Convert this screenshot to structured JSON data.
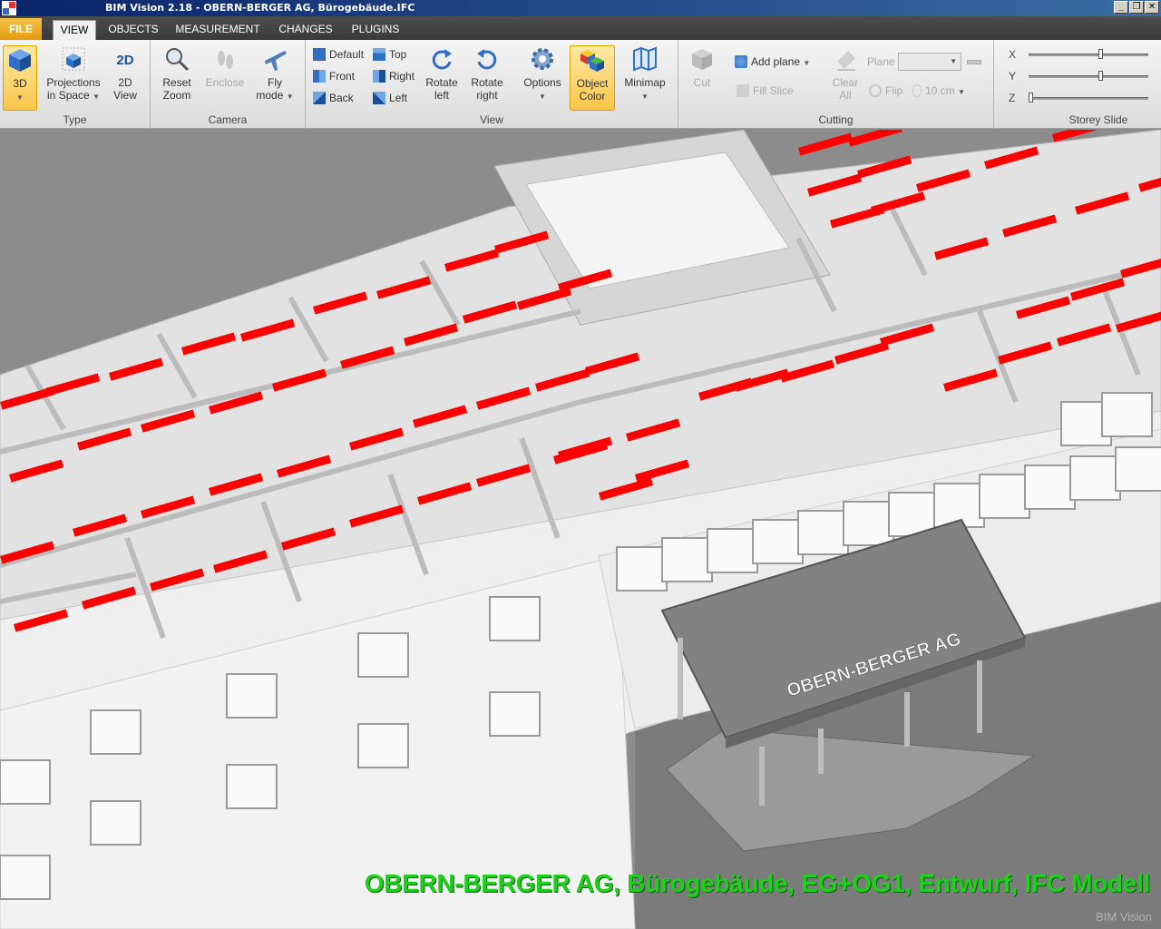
{
  "window": {
    "title": "BIM Vision 2.18 - OBERN-BERGER AG, Bürogebäude.IFC",
    "min_glyph": "_",
    "max_glyph": "❐",
    "close_glyph": "✕"
  },
  "tabs": [
    {
      "label": "FILE"
    },
    {
      "label": "VIEW"
    },
    {
      "label": "OBJECTS"
    },
    {
      "label": "MEASUREMENT"
    },
    {
      "label": "CHANGES"
    },
    {
      "label": "PLUGINS"
    }
  ],
  "ribbon": {
    "type_group": {
      "label": "Type",
      "btn_3d": "3D",
      "projections": "Projections",
      "projections_2": "in Space",
      "view_2d": "2D",
      "view_2d_2": "View"
    },
    "camera_group": {
      "label": "Camera",
      "reset": "Reset",
      "reset_2": "Zoom",
      "enclose": "Enclose",
      "fly": "Fly",
      "fly_2": "mode"
    },
    "view_group": {
      "label": "View",
      "default": "Default",
      "top": "Top",
      "front": "Front",
      "right": "Right",
      "back": "Back",
      "left": "Left",
      "rotate_left": "Rotate",
      "rotate_left_2": "left",
      "rotate_right": "Rotate",
      "rotate_right_2": "right",
      "options": "Options",
      "object_color": "Object",
      "object_color_2": "Color",
      "minimap": "Minimap"
    },
    "cutting_group": {
      "label": "Cutting",
      "cut": "Cut",
      "add_plane": "Add plane",
      "fill_slice": "Fill Slice",
      "clear_all": "Clear",
      "clear_all_2": "All",
      "plane": "Plane",
      "flip": "Flip",
      "offset": "10 cm"
    },
    "storey_group": {
      "label": "Storey Slide",
      "x": "X",
      "y": "Y",
      "z": "Z",
      "x_value": 0.6,
      "y_value": 0.6,
      "z_value": 0.0
    }
  },
  "viewport": {
    "caption": "OBERN-BERGER AG, Bürogebäude, EG+OG1, Entwurf, IFC Modell",
    "watermark": "BIM Vision",
    "canopy_sign": "OBERN-BERGER AG",
    "colors": {
      "background": "#8c8c8c",
      "walls": "#f2f2f2",
      "highlight": "#ff0000",
      "caption": "#1cd01c"
    }
  }
}
